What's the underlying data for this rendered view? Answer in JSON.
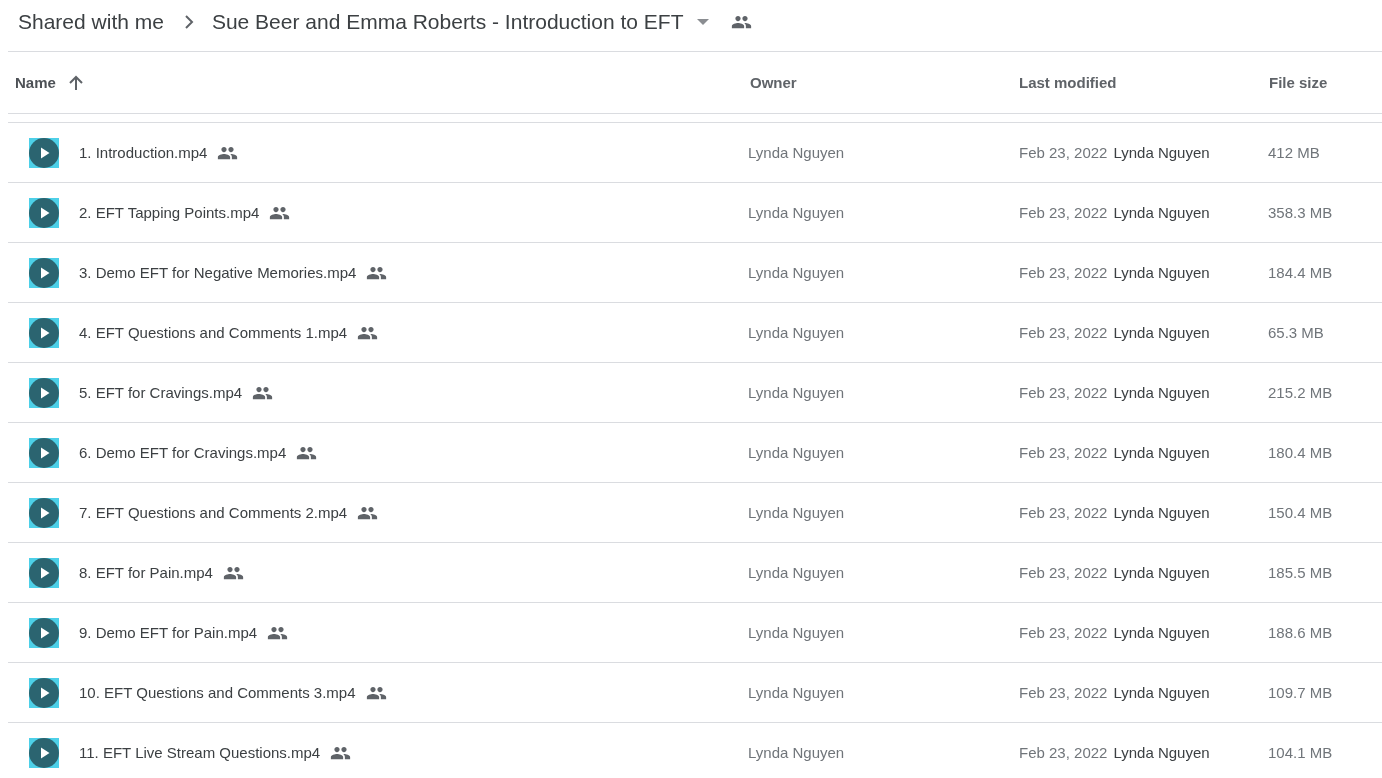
{
  "breadcrumb": {
    "parent": "Shared with me",
    "current": "Sue Beer and Emma Roberts - Introduction to EFT",
    "current_shared": true
  },
  "table": {
    "columns": [
      {
        "label": "Name",
        "sorted": true
      },
      {
        "label": "Owner",
        "sorted": false
      },
      {
        "label": "Last modified",
        "sorted": false
      },
      {
        "label": "File size",
        "sorted": false
      }
    ],
    "rows": [
      {
        "kind": "video",
        "name": "1. Introduction.mp4",
        "shared": true,
        "owner": "Lynda Nguyen",
        "modified_date": "Feb 23, 2022",
        "modified_by": "Lynda Nguyen",
        "size": "412 MB"
      },
      {
        "kind": "video",
        "name": "2. EFT Tapping Points.mp4",
        "shared": true,
        "owner": "Lynda Nguyen",
        "modified_date": "Feb 23, 2022",
        "modified_by": "Lynda Nguyen",
        "size": "358.3 MB"
      },
      {
        "kind": "video",
        "name": "3. Demo EFT for Negative Memories.mp4",
        "shared": true,
        "owner": "Lynda Nguyen",
        "modified_date": "Feb 23, 2022",
        "modified_by": "Lynda Nguyen",
        "size": "184.4 MB"
      },
      {
        "kind": "video",
        "name": "4. EFT Questions and Comments 1.mp4",
        "shared": true,
        "owner": "Lynda Nguyen",
        "modified_date": "Feb 23, 2022",
        "modified_by": "Lynda Nguyen",
        "size": "65.3 MB"
      },
      {
        "kind": "video",
        "name": "5. EFT for Cravings.mp4",
        "shared": true,
        "owner": "Lynda Nguyen",
        "modified_date": "Feb 23, 2022",
        "modified_by": "Lynda Nguyen",
        "size": "215.2 MB"
      },
      {
        "kind": "video",
        "name": "6. Demo EFT for Cravings.mp4",
        "shared": true,
        "owner": "Lynda Nguyen",
        "modified_date": "Feb 23, 2022",
        "modified_by": "Lynda Nguyen",
        "size": "180.4 MB"
      },
      {
        "kind": "video",
        "name": "7. EFT Questions and Comments 2.mp4",
        "shared": true,
        "owner": "Lynda Nguyen",
        "modified_date": "Feb 23, 2022",
        "modified_by": "Lynda Nguyen",
        "size": "150.4 MB"
      },
      {
        "kind": "video",
        "name": "8. EFT for Pain.mp4",
        "shared": true,
        "owner": "Lynda Nguyen",
        "modified_date": "Feb 23, 2022",
        "modified_by": "Lynda Nguyen",
        "size": "185.5 MB"
      },
      {
        "kind": "video",
        "name": "9. Demo EFT for Pain.mp4",
        "shared": true,
        "owner": "Lynda Nguyen",
        "modified_date": "Feb 23, 2022",
        "modified_by": "Lynda Nguyen",
        "size": "188.6 MB"
      },
      {
        "kind": "video",
        "name": "10. EFT Questions and Comments 3.mp4",
        "shared": true,
        "owner": "Lynda Nguyen",
        "modified_date": "Feb 23, 2022",
        "modified_by": "Lynda Nguyen",
        "size": "109.7 MB"
      },
      {
        "kind": "video",
        "name": "11. EFT Live Stream Questions.mp4",
        "shared": true,
        "owner": "Lynda Nguyen",
        "modified_date": "Feb 23, 2022",
        "modified_by": "Lynda Nguyen",
        "size": "104.1 MB"
      }
    ]
  }
}
